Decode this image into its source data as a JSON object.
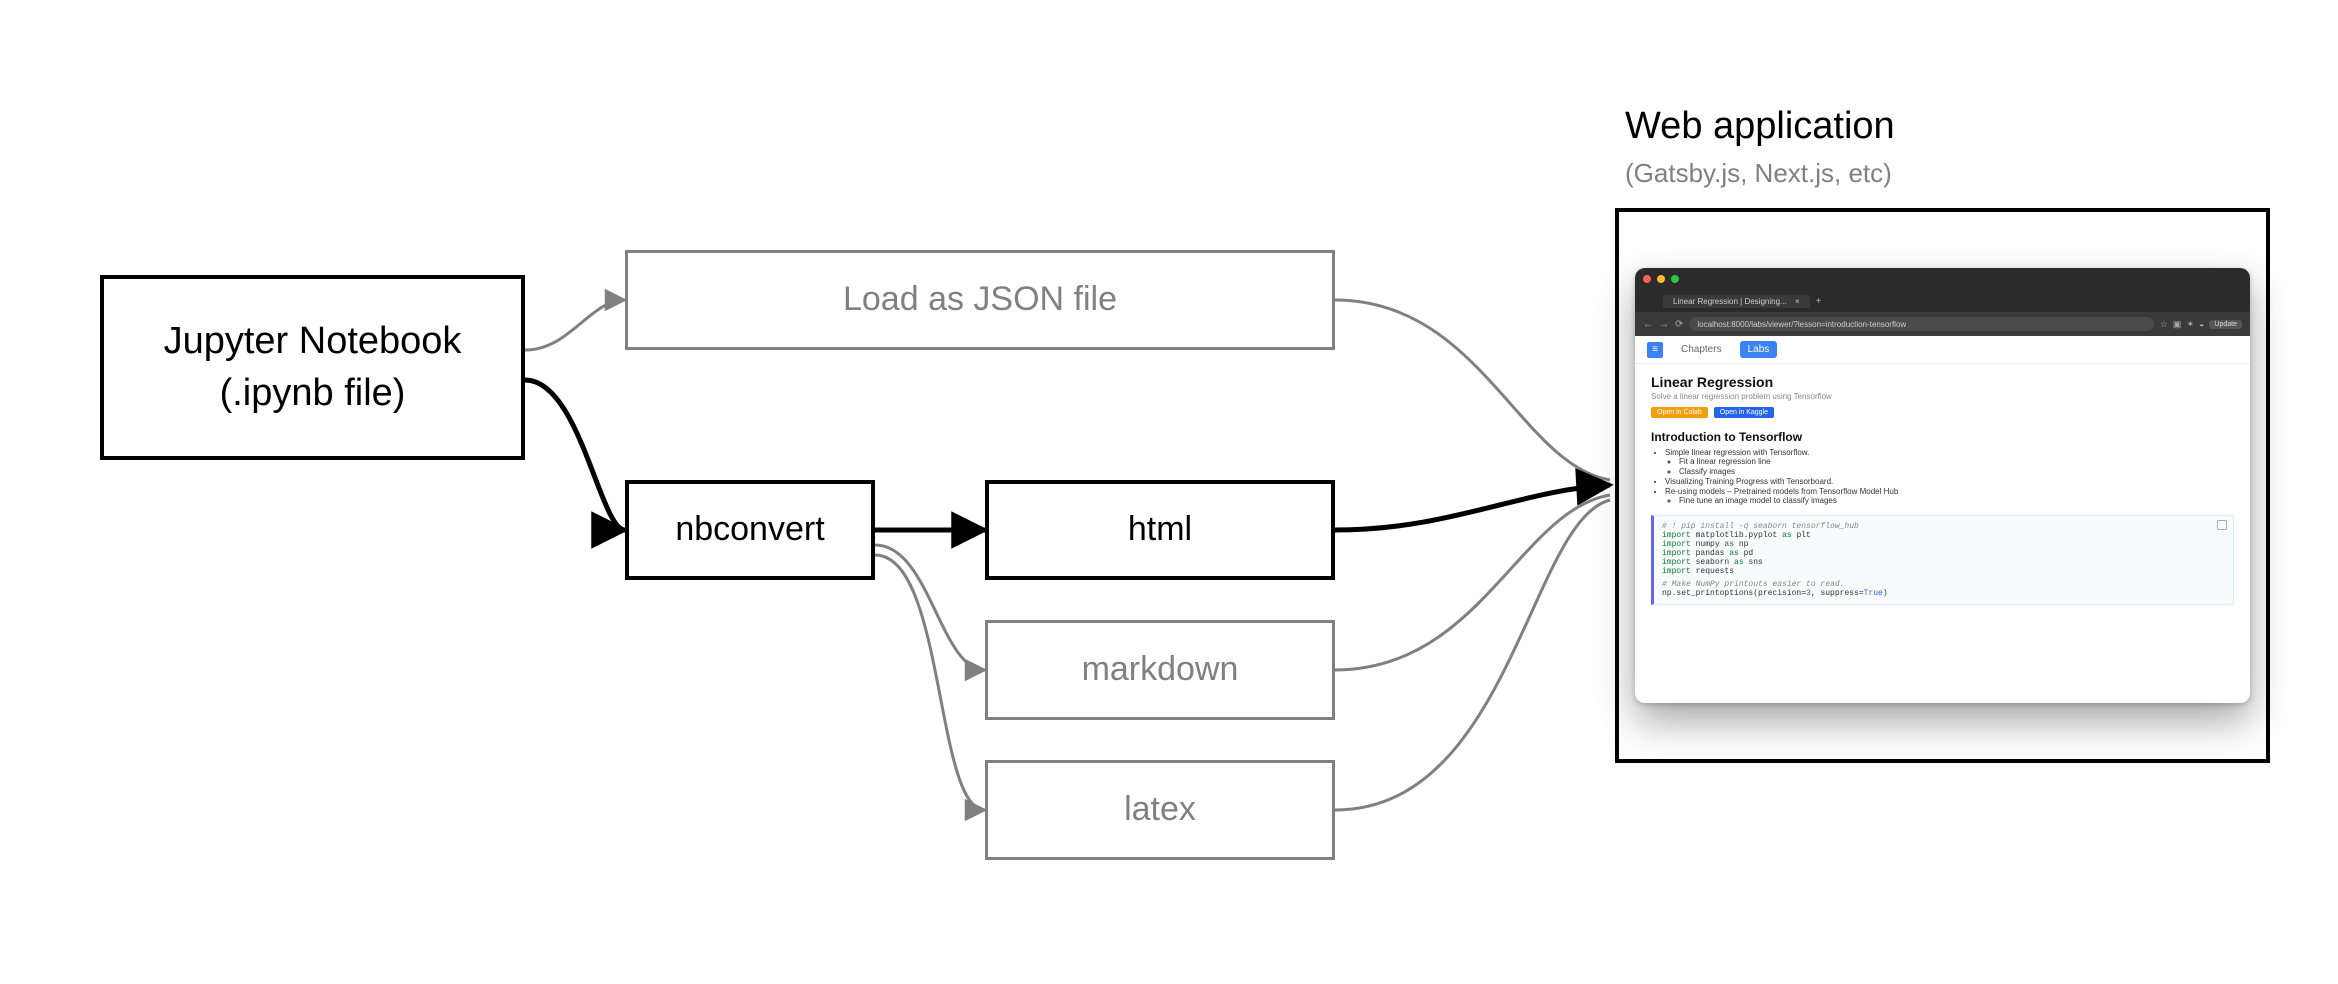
{
  "nodes": {
    "source": {
      "line1": "Jupyter Notebook",
      "line2": "(.ipynb file)"
    },
    "loadjson": "Load as JSON file",
    "nbconvert": "nbconvert",
    "html": "html",
    "markdown": "markdown",
    "latex": "latex"
  },
  "webapp": {
    "title": "Web application",
    "subtitle": "(Gatsby.js, Next.js, etc)"
  },
  "screenshot": {
    "browser": {
      "tab_title": "Linear Regression | Designing...",
      "url": "localhost:8000/labs/viewer/?lesson=introduction-tensorflow",
      "update_button": "Update"
    },
    "nav": {
      "chapters": "Chapters",
      "labs": "Labs"
    },
    "page": {
      "h1": "Linear Regression",
      "subtitle": "Solve a linear regression problem using Tensorflow",
      "badge_colab": "Open in Colab",
      "badge_kaggle": "Open in Kaggle",
      "h2": "Introduction to Tensorflow",
      "bullets": {
        "b1": "Simple linear regression with Tensorflow.",
        "b1a": "Fit a linear regression line",
        "b1b": "Classify images",
        "b2": "Visualizing Training Progress with Tensorboard.",
        "b3": "Re-using models – Pretrained models from Tensorflow Model Hub",
        "b3a": "Fine tune an image model to classify images"
      },
      "code": {
        "c1": "# ! pip install -q seaborn tensorflow_hub",
        "c2": "import matplotlib.pyplot as plt",
        "c3": "import numpy as np",
        "c4": "import pandas as pd",
        "c5": "import seaborn as sns",
        "c6": "import requests",
        "c7": "# Make NumPy printouts easier to read.",
        "c8": "np.set_printoptions(precision=3, suppress=True)"
      }
    }
  }
}
